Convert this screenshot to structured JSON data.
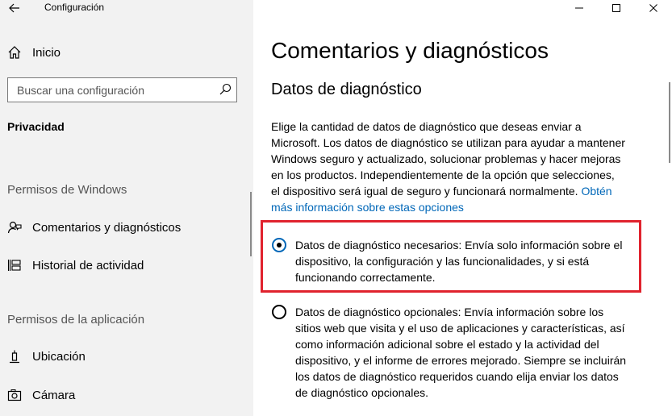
{
  "window": {
    "app_title": "Configuración"
  },
  "sidebar": {
    "home_label": "Inicio",
    "search": {
      "placeholder": "Buscar una configuración",
      "value": ""
    },
    "current_section": "Privacidad",
    "groups": [
      {
        "header": "Permisos de Windows",
        "items": [
          {
            "label": "Comentarios y diagnósticos",
            "icon": "feedback-icon"
          },
          {
            "label": "Historial de actividad",
            "icon": "timeline-icon"
          }
        ]
      },
      {
        "header": "Permisos de la aplicación",
        "items": [
          {
            "label": "Ubicación",
            "icon": "location-icon"
          },
          {
            "label": "Cámara",
            "icon": "camera-icon"
          }
        ]
      }
    ]
  },
  "main": {
    "title": "Comentarios y diagnósticos",
    "section_title": "Datos de diagnóstico",
    "description": "Elige la cantidad de datos de diagnóstico que deseas enviar a Microsoft. Los datos de diagnóstico se utilizan para ayudar a mantener Windows seguro y actualizado, solucionar problemas y hacer mejoras en los productos. Independientemente de la opción que selecciones, el dispositivo será igual de seguro y funcionará normalmente.",
    "link_text": "Obtén más información sobre estas opciones",
    "options": [
      {
        "label": "Datos de diagnóstico necesarios: Envía solo información sobre el dispositivo, la configuración y las funcionalidades, y si está funcionando correctamente.",
        "checked": true
      },
      {
        "label": "Datos de diagnóstico opcionales: Envía información sobre los sitios web que visita y el uso de aplicaciones y características, así como información adicional sobre el estado y la actividad del dispositivo, y el informe de errores mejorado. Siempre se incluirán los datos de diagnóstico requeridos cuando elija enviar los datos de diagnóstico opcionales.",
        "checked": false
      }
    ]
  },
  "colors": {
    "accent": "#0067b8",
    "highlight": "#e0232e",
    "sidebar_bg": "#f2f2f2"
  }
}
